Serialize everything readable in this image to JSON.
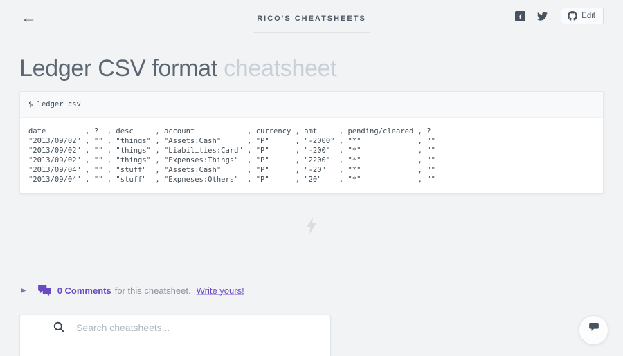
{
  "header": {
    "site_title": "RICO'S CHEATSHEETS",
    "edit_label": "Edit"
  },
  "icons": {
    "back_arrow": "←",
    "expander": "▶",
    "facebook_glyph": "f"
  },
  "page": {
    "title": "Ledger CSV format",
    "title_suffix": "cheatsheet"
  },
  "terminal": {
    "command": "$ ledger csv",
    "output_lines": [
      "date         , ?  , desc     , account            , currency , amt     , pending/cleared , ?",
      "\"2013/09/02\" , \"\" , \"things\" , \"Assets:Cash\"      , \"P\"      , \"-2000\" , \"*\"             , \"\"",
      "\"2013/09/02\" , \"\" , \"things\" , \"Liabilities:Card\" , \"P\"      , \"-200\"  , \"*\"             , \"\"",
      "\"2013/09/02\" , \"\" , \"things\" , \"Expenses:Things\"  , \"P\"      , \"2200\"  , \"*\"             , \"\"",
      "\"2013/09/04\" , \"\" , \"stuff\"  , \"Assets:Cash\"      , \"P\"      , \"-20\"   , \"*\"             , \"\"",
      "\"2013/09/04\" , \"\" , \"stuff\"  , \"Expneses:Others\"  , \"P\"      , \"20\"    , \"*\"             , \"\""
    ]
  },
  "comments": {
    "count_label": "0 Comments",
    "context_text": "for this cheatsheet.",
    "cta_label": "Write yours!"
  },
  "footer_search": {
    "placeholder": "Search cheatsheets..."
  },
  "colors": {
    "accent_purple": "#6a4ac2",
    "slate": "#46525e",
    "page_background": "#f1f3f5",
    "title_gray": "#5b6672",
    "title_light_gray": "#c8d0d7"
  }
}
